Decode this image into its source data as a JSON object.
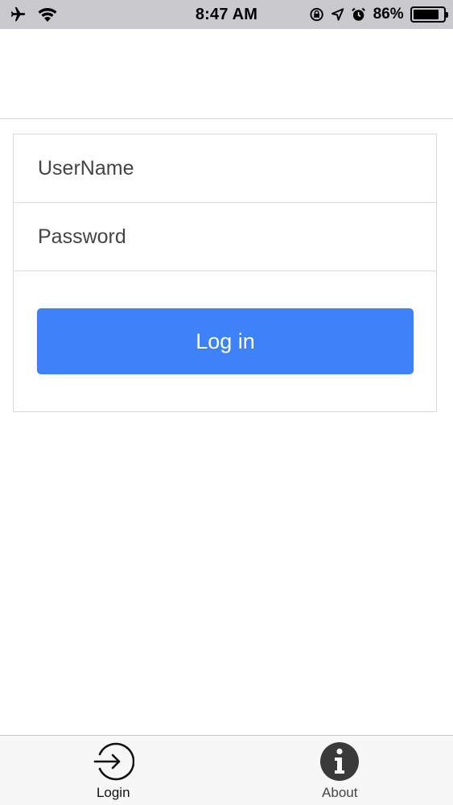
{
  "status_bar": {
    "time": "8:47 AM",
    "battery_percent": "86%",
    "battery_level": 0.86,
    "icons": [
      "airplane-icon",
      "wifi-icon",
      "orientation-lock-icon",
      "location-icon",
      "alarm-icon",
      "battery-icon"
    ]
  },
  "form": {
    "username_placeholder": "UserName",
    "password_placeholder": "Password",
    "login_label": "Log in"
  },
  "tabs": [
    {
      "label": "Login",
      "icon": "login-icon",
      "active": true
    },
    {
      "label": "About",
      "icon": "info-icon",
      "active": false
    }
  ],
  "colors": {
    "accent": "#3d82f6",
    "status_bar_bg": "#c9c9ce",
    "tab_bar_bg": "#f7f7f7",
    "info_icon_fill": "#3a3a3a"
  }
}
